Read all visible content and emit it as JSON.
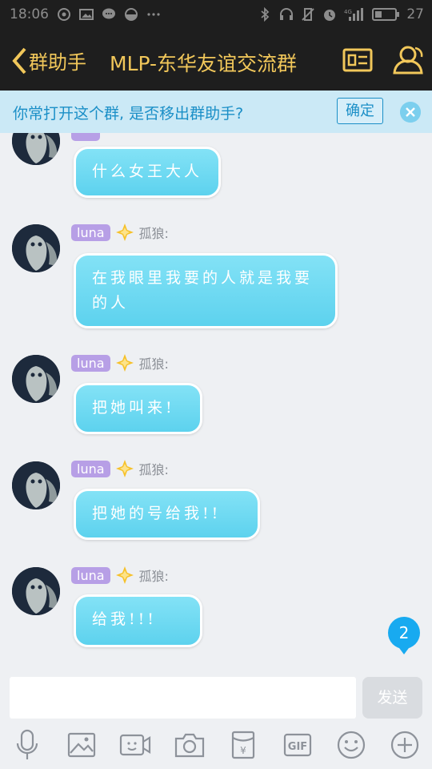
{
  "status_bar": {
    "time": "18:06",
    "battery": "27"
  },
  "header": {
    "back_label": "群助手",
    "title": "MLP-东华友谊交流群"
  },
  "banner": {
    "text": "你常打开这个群, 是否移出群助手?",
    "confirm_label": "确定"
  },
  "messages": [
    {
      "text": "什么女王大人"
    },
    {
      "tag": "luna",
      "nick": "孤狼:",
      "text_lines": [
        "在我眼里我要的人就是我要",
        "的人"
      ]
    },
    {
      "tag": "luna",
      "nick": "孤狼:",
      "text": "把她叫来!"
    },
    {
      "tag": "luna",
      "nick": "孤狼:",
      "text": "把她的号给我!!"
    },
    {
      "tag": "luna",
      "nick": "孤狼:",
      "text": "给我!!!"
    }
  ],
  "unread_count": "2",
  "input": {
    "value": "",
    "placeholder": "",
    "send_label": "发送"
  },
  "toolbar": {
    "gif_label": "GIF",
    "redpacket_label": "¥"
  },
  "colors": {
    "accent": "#f1c75a",
    "bubble": "#5dd2ee",
    "banner": "#cbe9f6",
    "link": "#1b8fc7",
    "tag": "#b79fe6",
    "unread": "#18aaf0"
  }
}
